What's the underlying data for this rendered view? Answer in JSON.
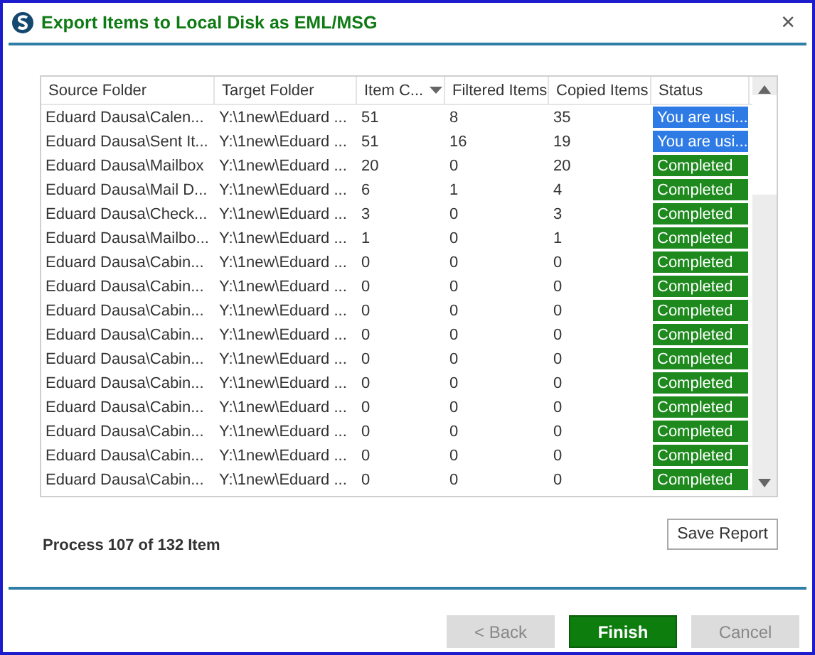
{
  "window": {
    "title": "Export Items to Local Disk as EML/MSG",
    "close": "×"
  },
  "table": {
    "columns": [
      {
        "label": "Source Folder"
      },
      {
        "label": "Target Folder"
      },
      {
        "label": "Item C...",
        "sort": true
      },
      {
        "label": "Filtered Items"
      },
      {
        "label": "Copied Items"
      },
      {
        "label": "Status"
      }
    ],
    "rows": [
      {
        "source": "Eduard Dausa\\Calen...",
        "target": "Y:\\1new\\Eduard ...",
        "count": "51",
        "filtered": "8",
        "copied": "35",
        "status": "You are usi...",
        "color": "#2f7be6"
      },
      {
        "source": "Eduard Dausa\\Sent It...",
        "target": "Y:\\1new\\Eduard ...",
        "count": "51",
        "filtered": "16",
        "copied": "19",
        "status": "You are usi...",
        "color": "#2f7be6"
      },
      {
        "source": "Eduard Dausa\\Mailbox",
        "target": "Y:\\1new\\Eduard ...",
        "count": "20",
        "filtered": "0",
        "copied": "20",
        "status": "Completed",
        "color": "#1e8a1e"
      },
      {
        "source": "Eduard Dausa\\Mail D...",
        "target": "Y:\\1new\\Eduard ...",
        "count": "6",
        "filtered": "1",
        "copied": "4",
        "status": "Completed",
        "color": "#1e8a1e"
      },
      {
        "source": "Eduard Dausa\\Check...",
        "target": "Y:\\1new\\Eduard ...",
        "count": "3",
        "filtered": "0",
        "copied": "3",
        "status": "Completed",
        "color": "#1e8a1e"
      },
      {
        "source": "Eduard Dausa\\Mailbo...",
        "target": "Y:\\1new\\Eduard ...",
        "count": "1",
        "filtered": "0",
        "copied": "1",
        "status": "Completed",
        "color": "#1e8a1e"
      },
      {
        "source": "Eduard Dausa\\Cabin...",
        "target": "Y:\\1new\\Eduard ...",
        "count": "0",
        "filtered": "0",
        "copied": "0",
        "status": "Completed",
        "color": "#1e8a1e"
      },
      {
        "source": "Eduard Dausa\\Cabin...",
        "target": "Y:\\1new\\Eduard ...",
        "count": "0",
        "filtered": "0",
        "copied": "0",
        "status": "Completed",
        "color": "#1e8a1e"
      },
      {
        "source": "Eduard Dausa\\Cabin...",
        "target": "Y:\\1new\\Eduard ...",
        "count": "0",
        "filtered": "0",
        "copied": "0",
        "status": "Completed",
        "color": "#1e8a1e"
      },
      {
        "source": "Eduard Dausa\\Cabin...",
        "target": "Y:\\1new\\Eduard ...",
        "count": "0",
        "filtered": "0",
        "copied": "0",
        "status": "Completed",
        "color": "#1e8a1e"
      },
      {
        "source": "Eduard Dausa\\Cabin...",
        "target": "Y:\\1new\\Eduard ...",
        "count": "0",
        "filtered": "0",
        "copied": "0",
        "status": "Completed",
        "color": "#1e8a1e"
      },
      {
        "source": "Eduard Dausa\\Cabin...",
        "target": "Y:\\1new\\Eduard ...",
        "count": "0",
        "filtered": "0",
        "copied": "0",
        "status": "Completed",
        "color": "#1e8a1e"
      },
      {
        "source": "Eduard Dausa\\Cabin...",
        "target": "Y:\\1new\\Eduard ...",
        "count": "0",
        "filtered": "0",
        "copied": "0",
        "status": "Completed",
        "color": "#1e8a1e"
      },
      {
        "source": "Eduard Dausa\\Cabin...",
        "target": "Y:\\1new\\Eduard ...",
        "count": "0",
        "filtered": "0",
        "copied": "0",
        "status": "Completed",
        "color": "#1e8a1e"
      },
      {
        "source": "Eduard Dausa\\Cabin...",
        "target": "Y:\\1new\\Eduard ...",
        "count": "0",
        "filtered": "0",
        "copied": "0",
        "status": "Completed",
        "color": "#1e8a1e"
      },
      {
        "source": "Eduard Dausa\\Cabin...",
        "target": "Y:\\1new\\Eduard ...",
        "count": "0",
        "filtered": "0",
        "copied": "0",
        "status": "Completed",
        "color": "#1e8a1e"
      }
    ]
  },
  "progress": "Process 107 of 132 Item",
  "save_report": "Save Report",
  "buttons": [
    {
      "label": "< Back",
      "kind": "default",
      "disabled": true
    },
    {
      "label": "Finish",
      "kind": "primary",
      "disabled": false
    },
    {
      "label": "Cancel",
      "kind": "default",
      "disabled": true
    }
  ]
}
